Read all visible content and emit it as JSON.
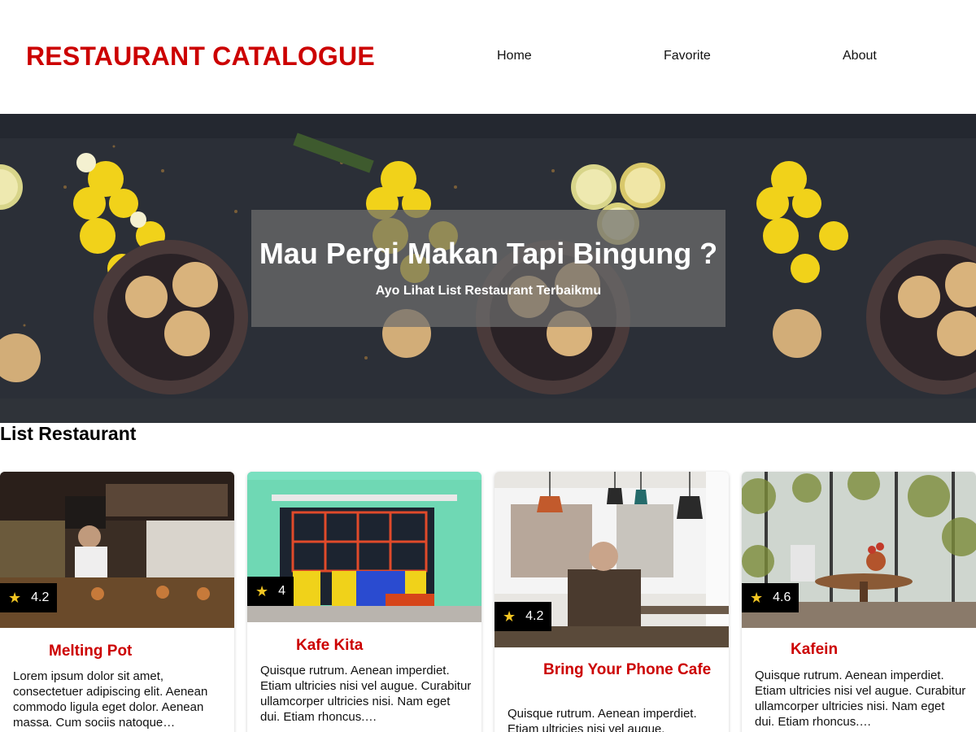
{
  "header": {
    "brand": "RESTAURANT CATALOGUE",
    "nav": [
      "Home",
      "Favorite",
      "About"
    ]
  },
  "hero": {
    "title": "Mau Pergi Makan Tapi Bingung ?",
    "subtitle": "Ayo Lihat List Restaurant Terbaikmu"
  },
  "list": {
    "title": "List Restaurant",
    "restaurants": [
      {
        "name": "Melting Pot",
        "rating": "4.2",
        "description": "Lorem ipsum dolor sit amet, consectetuer adipiscing elit. Aenean commodo ligula eget dolor. Aenean massa. Cum sociis natoque…"
      },
      {
        "name": "Kafe Kita",
        "rating": "4",
        "description": "Quisque rutrum. Aenean imperdiet. Etiam ultricies nisi vel augue. Curabitur ullamcorper ultricies nisi. Nam eget dui. Etiam rhoncus.…"
      },
      {
        "name": "Bring Your Phone Cafe",
        "rating": "4.2",
        "description": "Quisque rutrum. Aenean imperdiet. Etiam ultricies nisi vel augue."
      },
      {
        "name": "Kafein",
        "rating": "4.6",
        "description": "Quisque rutrum. Aenean imperdiet. Etiam ultricies nisi vel augue. Curabitur ullamcorper ultricies nisi. Nam eget dui. Etiam rhoncus.…"
      }
    ]
  },
  "colors": {
    "brand": "#cc0000",
    "rating_bg": "#000000",
    "star": "#f2c522",
    "hero_overlay": "rgba(110,110,110,0.72)"
  },
  "icons": {
    "rating": "star-icon"
  }
}
